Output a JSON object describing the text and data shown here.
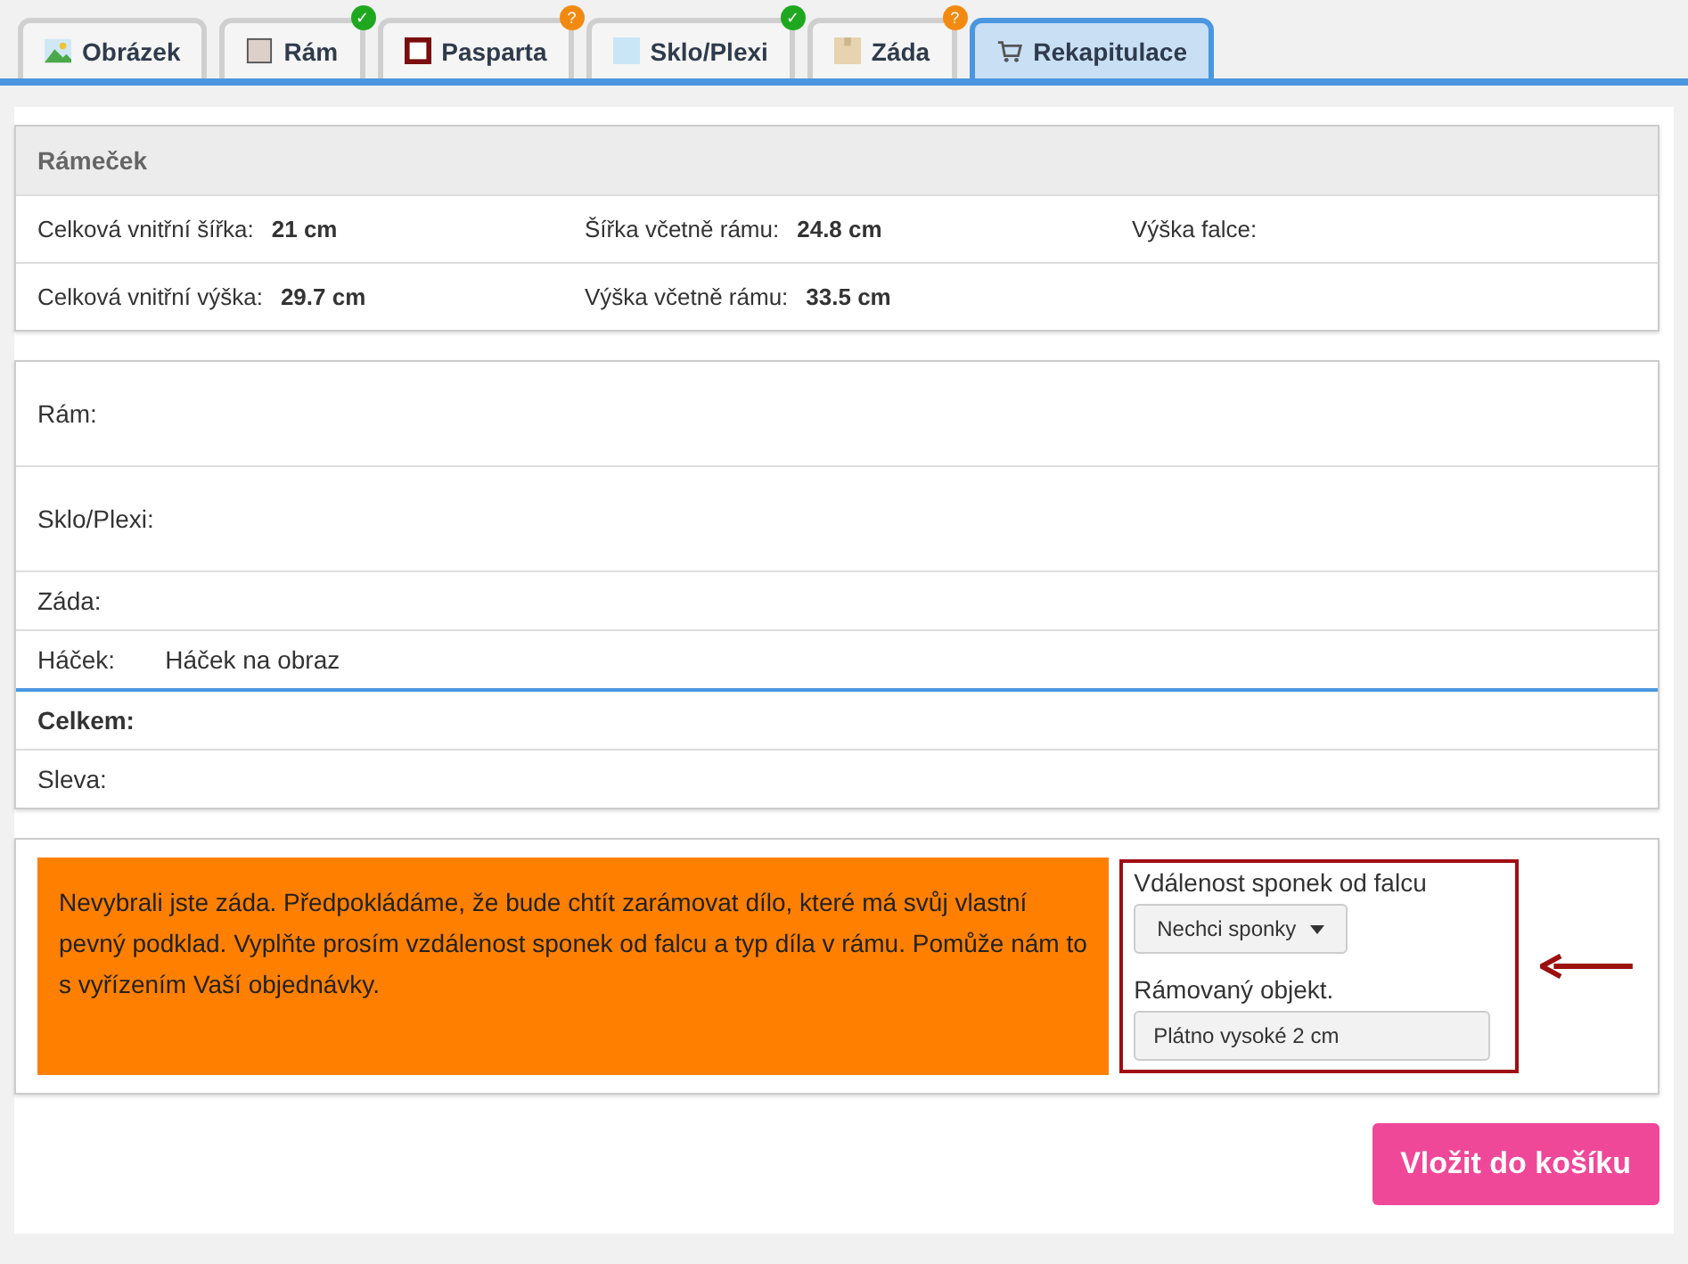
{
  "tabs": [
    {
      "label": "Obrázek",
      "selected": false
    },
    {
      "label": "Rám",
      "selected": false,
      "badge": {
        "text": "✓",
        "color": "#1fa81f"
      }
    },
    {
      "label": "Pasparta",
      "selected": false,
      "badge": {
        "text": "?",
        "color": "#f28a12"
      }
    },
    {
      "label": "Sklo/Plexi",
      "selected": false,
      "badge": {
        "text": "✓",
        "color": "#1fa81f"
      }
    },
    {
      "label": "Záda",
      "selected": false,
      "badge": {
        "text": "?",
        "color": "#f28a12"
      }
    },
    {
      "label": "Rekapitulace",
      "selected": true
    }
  ],
  "summary": {
    "title": "Rámeček",
    "rows": [
      [
        {
          "label": "Celková vnitřní šířka:",
          "value": "21 cm"
        },
        {
          "label": "Šířka včetně rámu:",
          "value": "24.8 cm"
        },
        {
          "label": "Výška falce:"
        }
      ],
      [
        {
          "label": "Celková vnitřní výška:",
          "value": "29.7 cm"
        },
        {
          "label": "Výška včetně rámu:",
          "value": "33.5 cm"
        }
      ]
    ]
  },
  "items": [
    {
      "label": "Rám:",
      "kind": "tall"
    },
    {
      "label": "Sklo/Plexi:",
      "kind": "tall"
    },
    {
      "label": "Záda:",
      "kind": "plain"
    },
    {
      "label": "Háček:",
      "value": "Háček na obraz",
      "kind": "plain"
    },
    {
      "label": "Celkem:",
      "kind": "total"
    },
    {
      "label": "Sleva:",
      "kind": "plain"
    }
  ],
  "notice": {
    "text": "Nevybrali jste záda. Předpokládáme, že bude chtít zarámovat dílo, které má svůj vlastní pevný podklad. Vyplňte prosím vzdálenost sponek od falcu a typ díla v rámu. Pomůže nám to s vyřízením Vaší objednávky.",
    "clips_label": "Vdálenost sponek od falcu",
    "clips_value": "Nechci sponky",
    "object_label": "Rámovaný objekt.",
    "object_value": "Plátno vysoké 2 cm"
  },
  "submit": "Vložit do košíku"
}
